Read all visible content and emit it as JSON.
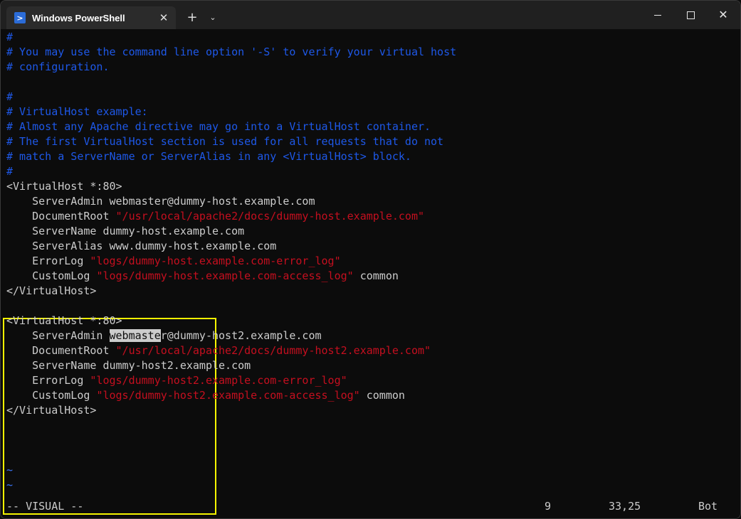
{
  "window": {
    "tab_title": "Windows PowerShell",
    "tab_icon": "powershell-icon",
    "new_tab_label": "+",
    "dropdown_label": "⌄",
    "controls": {
      "minimize": "minimize-icon",
      "maximize": "maximize-icon",
      "close": "close-icon"
    }
  },
  "colors": {
    "comment": "#1e58e8",
    "string": "#c50f1f",
    "text": "#cccccc",
    "tilde": "#3b78ff",
    "background": "#0c0c0c",
    "highlight_box": "#f5f500"
  },
  "editor": {
    "lines": [
      {
        "segments": [
          {
            "t": "#",
            "c": "comment"
          }
        ]
      },
      {
        "segments": [
          {
            "t": "# You may use the command line option '-S' to verify your virtual host",
            "c": "comment"
          }
        ]
      },
      {
        "segments": [
          {
            "t": "# configuration.",
            "c": "comment"
          }
        ]
      },
      {
        "segments": []
      },
      {
        "segments": [
          {
            "t": "#",
            "c": "comment"
          }
        ]
      },
      {
        "segments": [
          {
            "t": "# VirtualHost example:",
            "c": "comment"
          }
        ]
      },
      {
        "segments": [
          {
            "t": "# Almost any Apache directive may go into a VirtualHost container.",
            "c": "comment"
          }
        ]
      },
      {
        "segments": [
          {
            "t": "# The first VirtualHost section is used for all requests that do not",
            "c": "comment"
          }
        ]
      },
      {
        "segments": [
          {
            "t": "# match a ServerName or ServerAlias in any <VirtualHost> block.",
            "c": "comment"
          }
        ]
      },
      {
        "segments": [
          {
            "t": "#",
            "c": "comment"
          }
        ]
      },
      {
        "segments": [
          {
            "t": "<VirtualHost *:80>",
            "c": "text"
          }
        ]
      },
      {
        "segments": [
          {
            "t": "    ServerAdmin webmaster@dummy-host.example.com",
            "c": "text"
          }
        ]
      },
      {
        "segments": [
          {
            "t": "    DocumentRoot ",
            "c": "text"
          },
          {
            "t": "\"/usr/local/apache2/docs/dummy-host.example.com\"",
            "c": "string"
          }
        ]
      },
      {
        "segments": [
          {
            "t": "    ServerName dummy-host.example.com",
            "c": "text"
          }
        ]
      },
      {
        "segments": [
          {
            "t": "    ServerAlias www.dummy-host.example.com",
            "c": "text"
          }
        ]
      },
      {
        "segments": [
          {
            "t": "    ErrorLog ",
            "c": "text"
          },
          {
            "t": "\"logs/dummy-host.example.com-error_log\"",
            "c": "string"
          }
        ]
      },
      {
        "segments": [
          {
            "t": "    CustomLog ",
            "c": "text"
          },
          {
            "t": "\"logs/dummy-host.example.com-access_log\"",
            "c": "string"
          },
          {
            "t": " common",
            "c": "text"
          }
        ]
      },
      {
        "segments": [
          {
            "t": "</VirtualHost>",
            "c": "text"
          }
        ]
      },
      {
        "segments": []
      },
      {
        "segments": [
          {
            "t": "<VirtualHost *:80>",
            "c": "text"
          }
        ]
      },
      {
        "segments": [
          {
            "t": "    ServerAdmin ",
            "c": "text"
          },
          {
            "t": "webmaste",
            "c": "sel"
          },
          {
            "t": "r@dummy-host2.example.com",
            "c": "text"
          }
        ]
      },
      {
        "segments": [
          {
            "t": "    DocumentRoot ",
            "c": "text"
          },
          {
            "t": "\"/usr/local/apache2/docs/dummy-host2.example.com\"",
            "c": "string"
          }
        ]
      },
      {
        "segments": [
          {
            "t": "    ServerName dummy-host2.example.com",
            "c": "text"
          }
        ]
      },
      {
        "segments": [
          {
            "t": "    ErrorLog ",
            "c": "text"
          },
          {
            "t": "\"logs/dummy-host2.example.com-error_log\"",
            "c": "string"
          }
        ]
      },
      {
        "segments": [
          {
            "t": "    CustomLog ",
            "c": "text"
          },
          {
            "t": "\"logs/dummy-host2.example.com-access_log\"",
            "c": "string"
          },
          {
            "t": " common",
            "c": "text"
          }
        ]
      },
      {
        "segments": [
          {
            "t": "</VirtualHost>",
            "c": "text"
          }
        ]
      },
      {
        "segments": []
      },
      {
        "segments": []
      },
      {
        "segments": []
      },
      {
        "segments": [
          {
            "t": "~",
            "c": "tilde"
          }
        ]
      },
      {
        "segments": [
          {
            "t": "~",
            "c": "tilde"
          }
        ]
      }
    ]
  },
  "statusline": {
    "mode": "-- VISUAL --",
    "selection_count": "9",
    "cursor_position": "33,25",
    "scroll": "Bot"
  }
}
